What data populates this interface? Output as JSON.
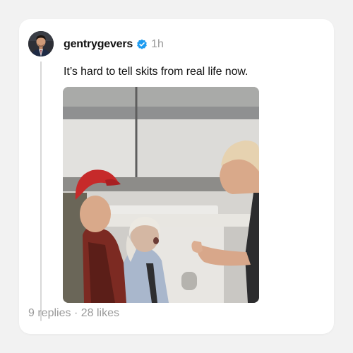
{
  "post": {
    "username": "gentrygevers",
    "time": "1h",
    "text": "It’s hard to tell skits from real life now.",
    "replies": "9 replies",
    "likes": "28 likes",
    "separator": "·"
  },
  "icons": {
    "verified": "verified-badge-icon",
    "avatar": "user-avatar"
  },
  "colors": {
    "verified_blue": "#1d9bf0",
    "background": "#f2f2f2",
    "card": "#ffffff",
    "muted_text": "#9a9a9a"
  }
}
